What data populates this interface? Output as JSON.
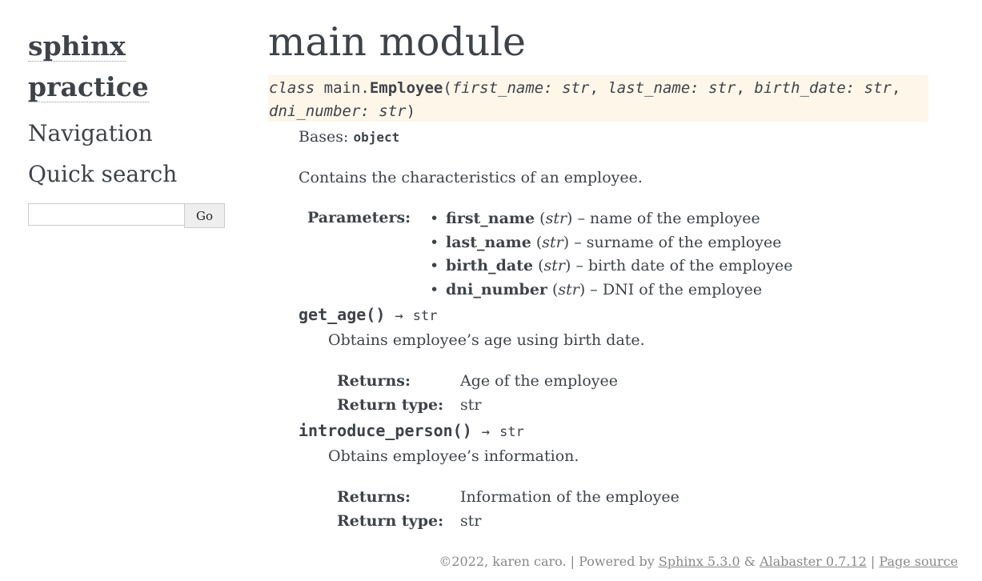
{
  "sidebar": {
    "logo_line1": "sphinx",
    "logo_line2": "practice",
    "navigation_heading": "Navigation",
    "quick_search_heading": "Quick search",
    "search": {
      "value": "",
      "placeholder": "",
      "button_label": "Go"
    }
  },
  "main": {
    "title": "main module",
    "class_signature": {
      "keyword": "class",
      "module_prefix": "main.",
      "name": "Employee",
      "open_paren": "(",
      "params": [
        {
          "name": "first_name",
          "type": "str"
        },
        {
          "name": "last_name",
          "type": "str"
        },
        {
          "name": "birth_date",
          "type": "str"
        },
        {
          "name": "dni_number",
          "type": "str"
        }
      ],
      "close_paren": ")"
    },
    "bases_label": "Bases:",
    "bases_value": "object",
    "description": "Contains the characteristics of an employee.",
    "parameters_label": "Parameters:",
    "parameters": [
      {
        "name": "first_name",
        "type": "str",
        "desc": "name of the employee"
      },
      {
        "name": "last_name",
        "type": "str",
        "desc": "surname of the employee"
      },
      {
        "name": "birth_date",
        "type": "str",
        "desc": "birth date of the employee"
      },
      {
        "name": "dni_number",
        "type": "str",
        "desc": "DNI of the employee"
      }
    ],
    "methods": [
      {
        "name": "get_age",
        "parens": "()",
        "arrow": "→",
        "return_annotation": "str",
        "description": "Obtains employee’s age using birth date.",
        "returns_label": "Returns:",
        "returns_value": "Age of the employee",
        "return_type_label": "Return type:",
        "return_type_value": "str"
      },
      {
        "name": "introduce_person",
        "parens": "()",
        "arrow": "→",
        "return_annotation": "str",
        "description": "Obtains employee’s information.",
        "returns_label": "Returns:",
        "returns_value": "Information of the employee",
        "return_type_label": "Return type:",
        "return_type_value": "str"
      }
    ]
  },
  "footer": {
    "copyright": "©2022, karen caro.",
    "sep1": "|",
    "powered_by": "Powered by",
    "sphinx_link": "Sphinx 5.3.0",
    "amp": "&",
    "alabaster_link": "Alabaster 0.7.12",
    "sep2": "|",
    "page_source_link": "Page source"
  }
}
